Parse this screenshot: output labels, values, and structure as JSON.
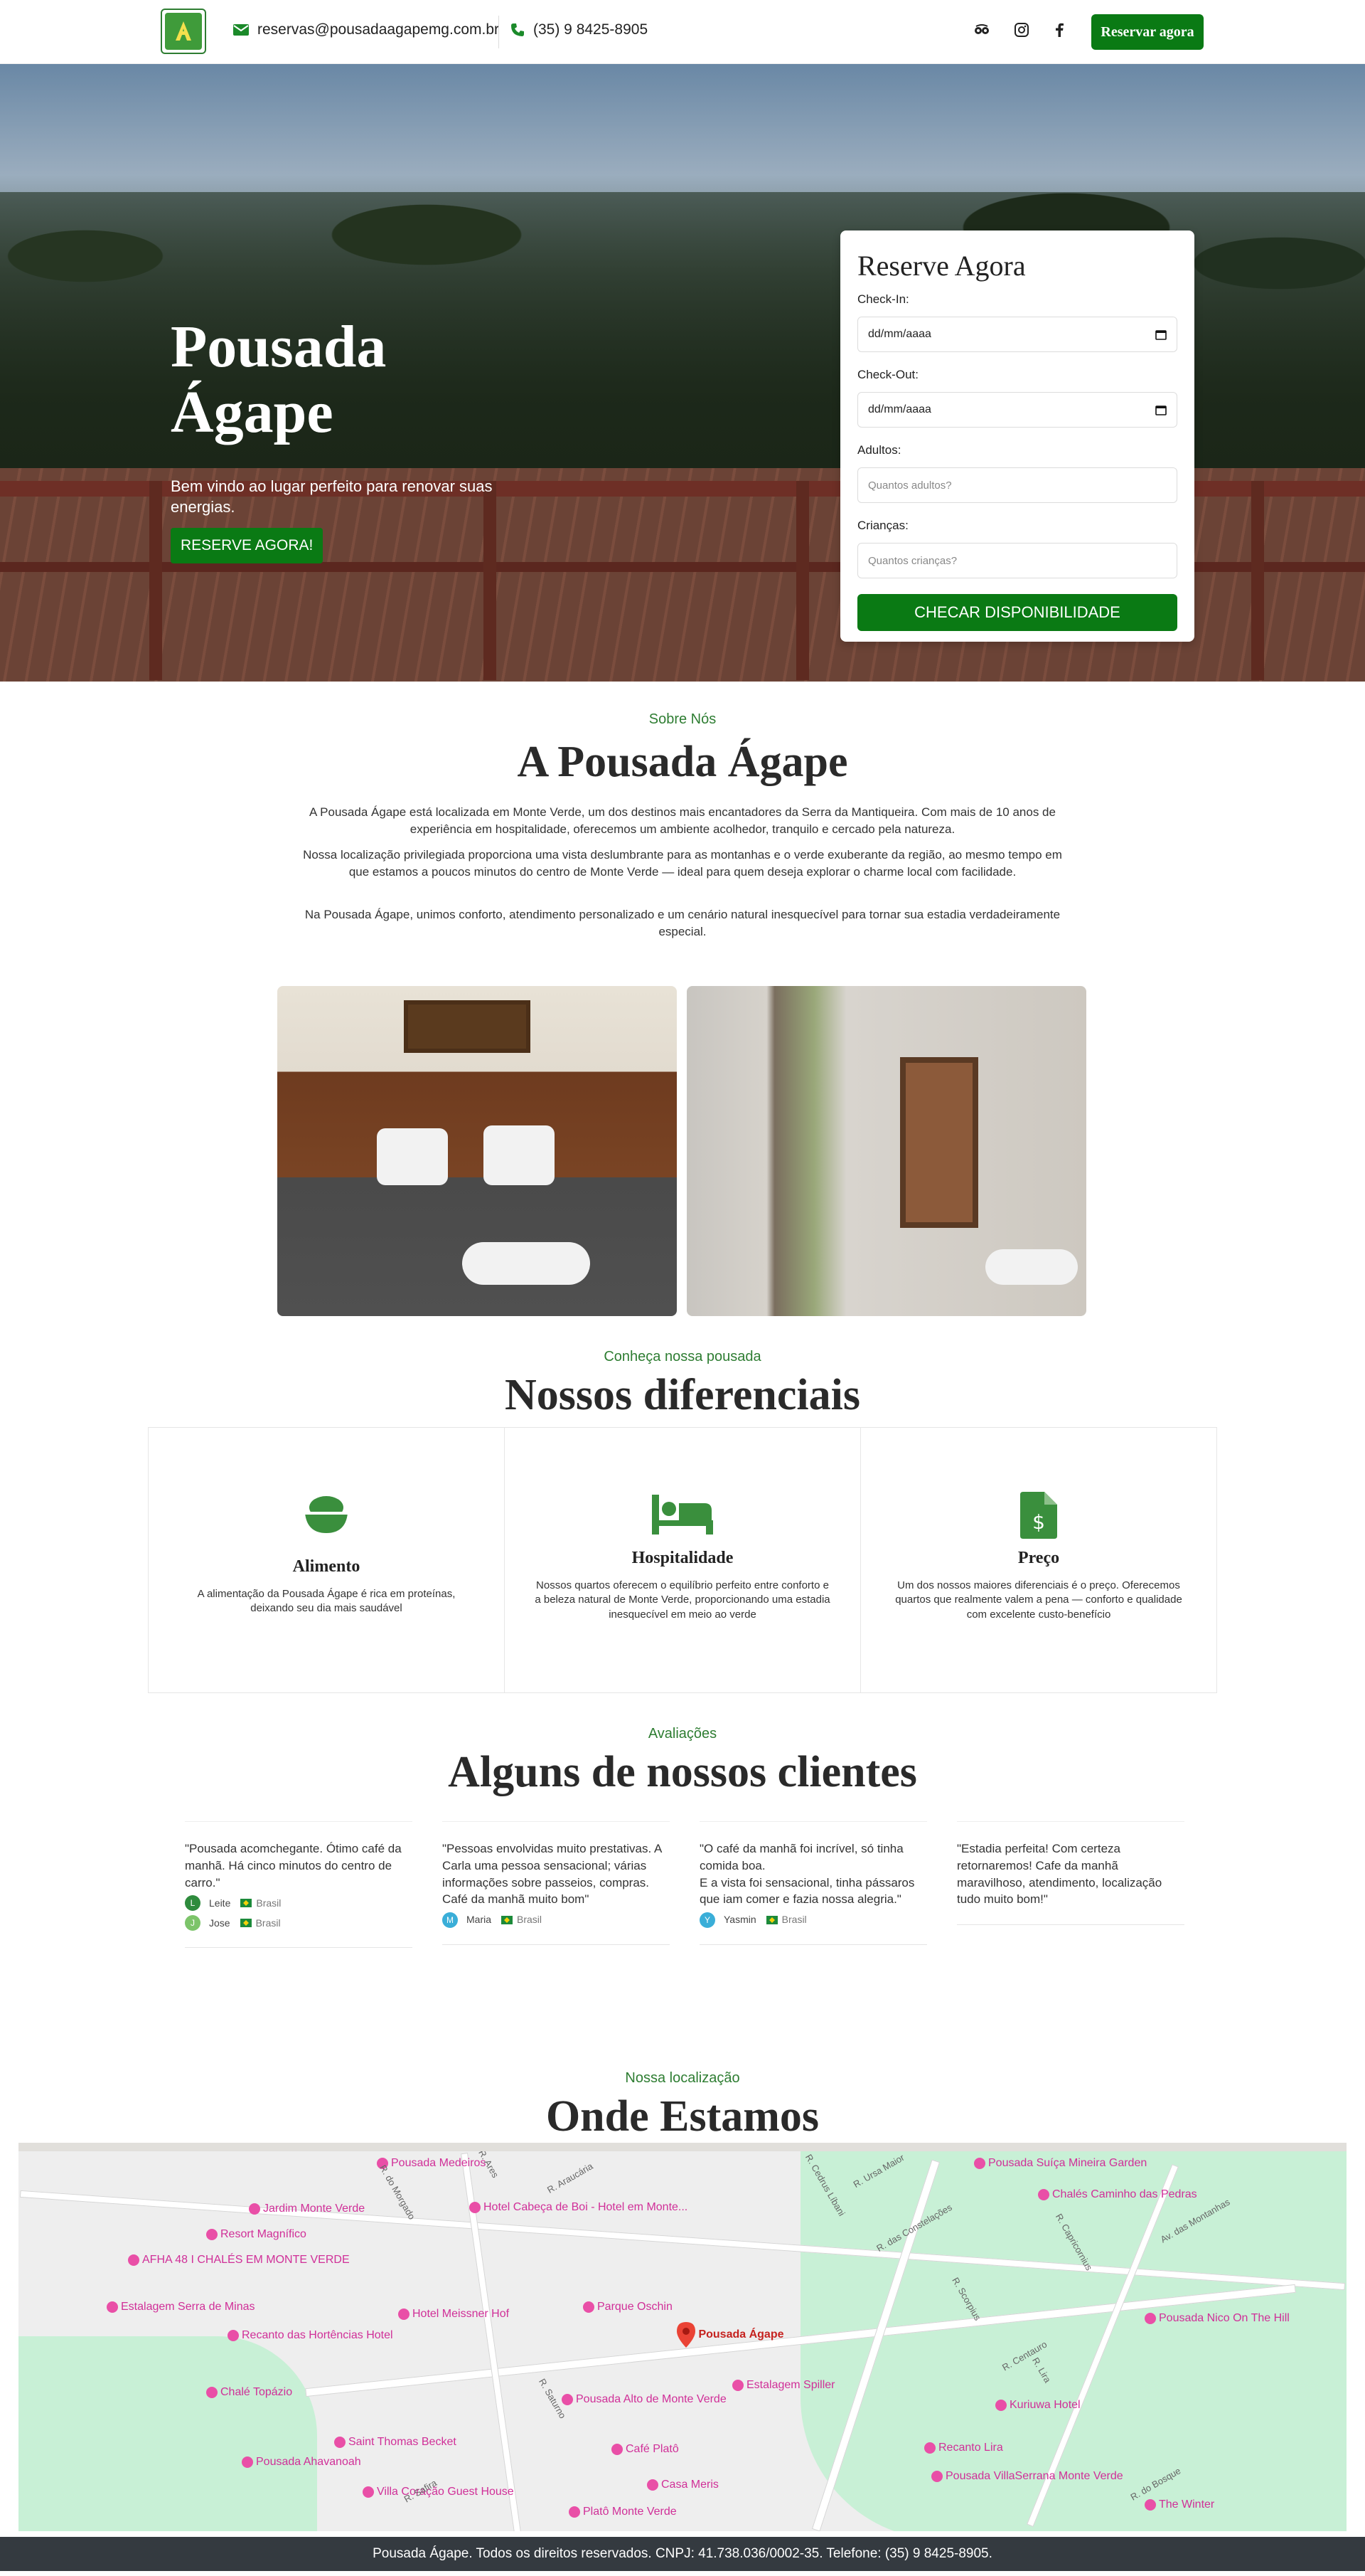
{
  "topbar": {
    "logo_alt": "Pousada Ágape logo",
    "email": "reservas@pousadaagapemg.com.br",
    "phone": "(35) 9 8425-8905",
    "reserve_label": "Reservar agora",
    "icons": [
      "envelope-icon",
      "phone-icon",
      "tripadvisor-icon",
      "instagram-icon",
      "facebook-icon"
    ]
  },
  "hero": {
    "title": "Pousada Ágape",
    "subtitle": "Bem vindo ao lugar perfeito para renovar suas energias.",
    "cta": "RESERVE AGORA!"
  },
  "booking": {
    "title": "Reserve Agora",
    "checkin_label": "Check-In:",
    "checkin_value": "dd/mm/aaaa",
    "checkout_label": "Check-Out:",
    "checkout_value": "dd/mm/aaaa",
    "adults_label": "Adultos:",
    "adults_placeholder": "Quantos adultos?",
    "children_label": "Crianças:",
    "children_placeholder": "Quantos crianças?",
    "submit": "CHECAR DISPONIBILIDADE"
  },
  "about": {
    "eyebrow": "Sobre Nós",
    "title": "A Pousada Ágape",
    "p1": "A Pousada Ágape está localizada em Monte Verde, um dos destinos mais encantadores da Serra da Mantiqueira. Com mais de 10 anos de experiência em hospitalidade, oferecemos um ambiente acolhedor, tranquilo e cercado pela natureza.",
    "p2": "Nossa localização privilegiada proporciona uma vista deslumbrante para as montanhas e o verde exuberante da região, ao mesmo tempo em que estamos a poucos minutos do centro de Monte Verde — ideal para quem deseja explorar o charme local com facilidade.",
    "p3": "Na Pousada Ágape, unimos conforto, atendimento personalizado e um cenário natural inesquecível para tornar sua estadia verdadeiramente especial."
  },
  "differentials": {
    "eyebrow": "Conheça nossa pousada",
    "title": "Nossos diferenciais",
    "items": [
      {
        "icon": "food-bowl-icon",
        "title": "Alimento",
        "text": "A alimentação da Pousada Ágape é rica em proteínas, deixando seu dia mais saudável"
      },
      {
        "icon": "bed-icon",
        "title": "Hospitalidade",
        "text": "Nossos quartos oferecem o equilíbrio perfeito entre conforto e a beleza natural de Monte Verde, proporcionando uma estadia inesquecível em meio ao verde"
      },
      {
        "icon": "price-document-icon",
        "title": "Preço",
        "text": "Um dos nossos maiores diferenciais é o preço. Oferecemos quartos que realmente valem a pena — conforto e qualidade com excelente custo-benefício"
      }
    ]
  },
  "reviews": {
    "eyebrow": "Avaliações",
    "title": "Alguns de nossos clientes",
    "items": [
      {
        "quote": "\"Pousada acomchegante. Ótimo café da manhã. Há cinco minutos do centro de carro.\"",
        "authors": [
          {
            "initial": "L",
            "name": "Leite",
            "country": "Brasil",
            "color": "#2e8b3d"
          },
          {
            "initial": "J",
            "name": "Jose",
            "country": "Brasil",
            "color": "#7cc46a"
          }
        ]
      },
      {
        "quote": "\"Pessoas envolvidas muito prestativas. A Carla uma pessoa sensacional; várias informações sobre passeios, compras. Café da manhã muito bom\"",
        "authors": [
          {
            "initial": "M",
            "name": "Maria",
            "country": "Brasil",
            "color": "#3aaed8"
          }
        ]
      },
      {
        "quote": "\"O café da manhã foi incrível, só tinha comida boa.\nE a vista foi sensacional, tinha pássaros que iam comer e fazia nossa alegria.\"",
        "authors": [
          {
            "initial": "Y",
            "name": "Yasmin",
            "country": "Brasil",
            "color": "#3aaed8"
          }
        ]
      },
      {
        "quote": "\"Estadia perfeita! Com certeza retornaremos! Cafe da manhã maravilhoso, atendimento, localização tudo muito bom!\"",
        "authors": []
      }
    ]
  },
  "location": {
    "eyebrow": "Nossa localização",
    "title": "Onde Estamos",
    "main_pin": "Pousada Ágape",
    "places": [
      "Pousada Medeiros",
      "Jardim Monte Verde",
      "Resort Magnífico",
      "AFHA 48 I CHALÉS EM MONTE VERDE",
      "Estalagem Serra de Minas",
      "Recanto das Hortências Hotel",
      "Chalé Topázio",
      "Pousada Ahavanoah",
      "Villa Coração Guest House",
      "Hotel Cabeça de Boi - Hotel em Monte...",
      "Hotel Meissner Hof",
      "Parque Oschin",
      "Pousada Alto de Monte Verde",
      "Saint Thomas Becket",
      "Café Platô",
      "Casa Meris",
      "Platô Monte Verde",
      "Estalagem Spiller",
      "Pousada Suíça Mineira Garden",
      "Chalés Caminho das Pedras",
      "Pousada Nico On The Hill",
      "Kuriuwa Hotel",
      "Recanto Lira",
      "Pousada VillaSerrana Monte Verde",
      "The Winter"
    ],
    "streets": [
      "R. Araucária",
      "R. do Morgado",
      "R. Ursa Maior",
      "R. Cedrus Líbani",
      "R. das Constelações",
      "R. Capricornius",
      "Av. das Montanhas",
      "R. Scorpius",
      "R. Centauro",
      "R. Lira",
      "R. do Bosque",
      "R. Saturno",
      "R. Safira",
      "R. Ares"
    ]
  },
  "footer": {
    "text": "Pousada Ágape. Todos os direitos reservados. CNPJ: 41.738.036/0002-35. Telefone: (35) 9 8425-8905."
  }
}
